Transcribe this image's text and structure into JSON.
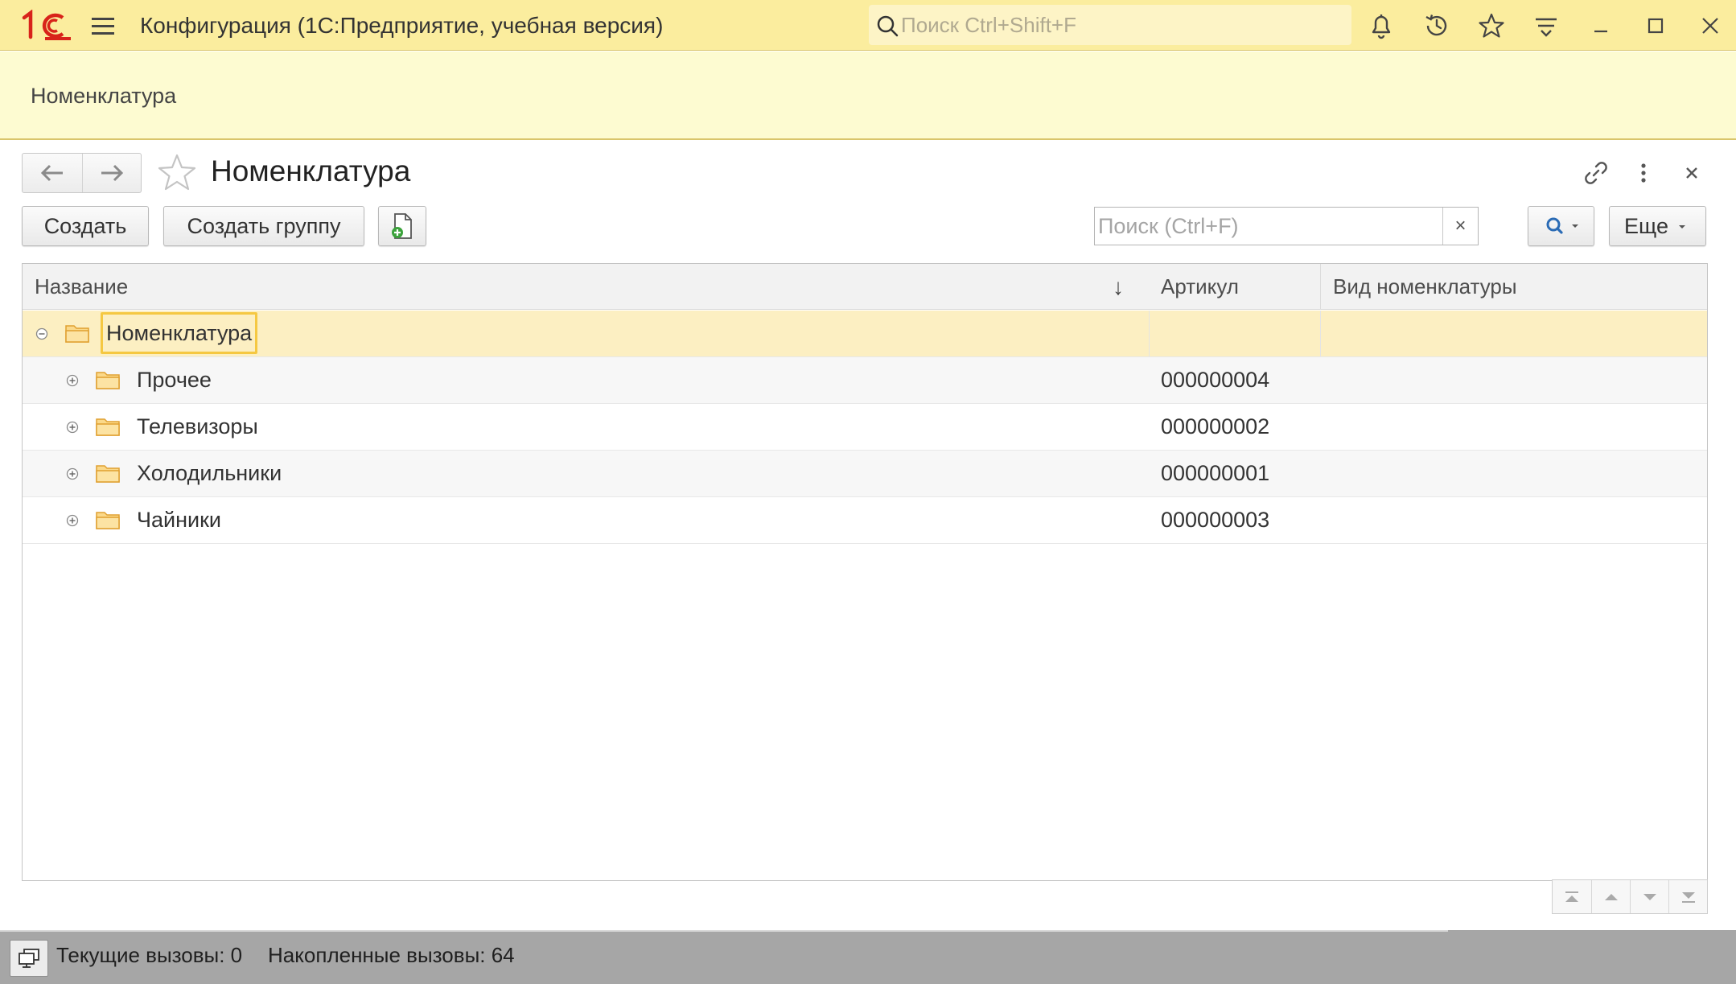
{
  "titlebar": {
    "title": "Конфигурация  (1С:Предприятие, учебная версия)",
    "search_placeholder": "Поиск Ctrl+Shift+F",
    "logo_text": "1С",
    "accent_color": "#fbed9e",
    "logo_color": "#d8231a",
    "icons": [
      "notifications-bell-icon",
      "history-icon",
      "favorites-star-icon",
      "more-menu-icon",
      "minimize-icon",
      "maximize-icon",
      "close-icon"
    ]
  },
  "section": {
    "label": "Номенклатура"
  },
  "form": {
    "title": "Номенклатура",
    "toolbar": {
      "create_label": "Создать",
      "create_group_label": "Создать группу",
      "search_placeholder": "Поиск (Ctrl+F)",
      "clear_label": "×",
      "more_label": "Еще"
    }
  },
  "table": {
    "columns": {
      "name": "Название",
      "article": "Артикул",
      "kind": "Вид номенклатуры"
    },
    "sort_indicator": "↓",
    "root": {
      "name": "Номенклатура",
      "article": "",
      "kind": ""
    },
    "rows": [
      {
        "name": "Прочее",
        "article": "000000004",
        "kind": ""
      },
      {
        "name": "Телевизоры",
        "article": "000000002",
        "kind": ""
      },
      {
        "name": "Холодильники",
        "article": "000000001",
        "kind": ""
      },
      {
        "name": "Чайники",
        "article": "000000003",
        "kind": ""
      }
    ]
  },
  "statusbar": {
    "current_calls": "Текущие вызовы: 0",
    "accumulated_calls": "Накопленные вызовы: 64"
  }
}
